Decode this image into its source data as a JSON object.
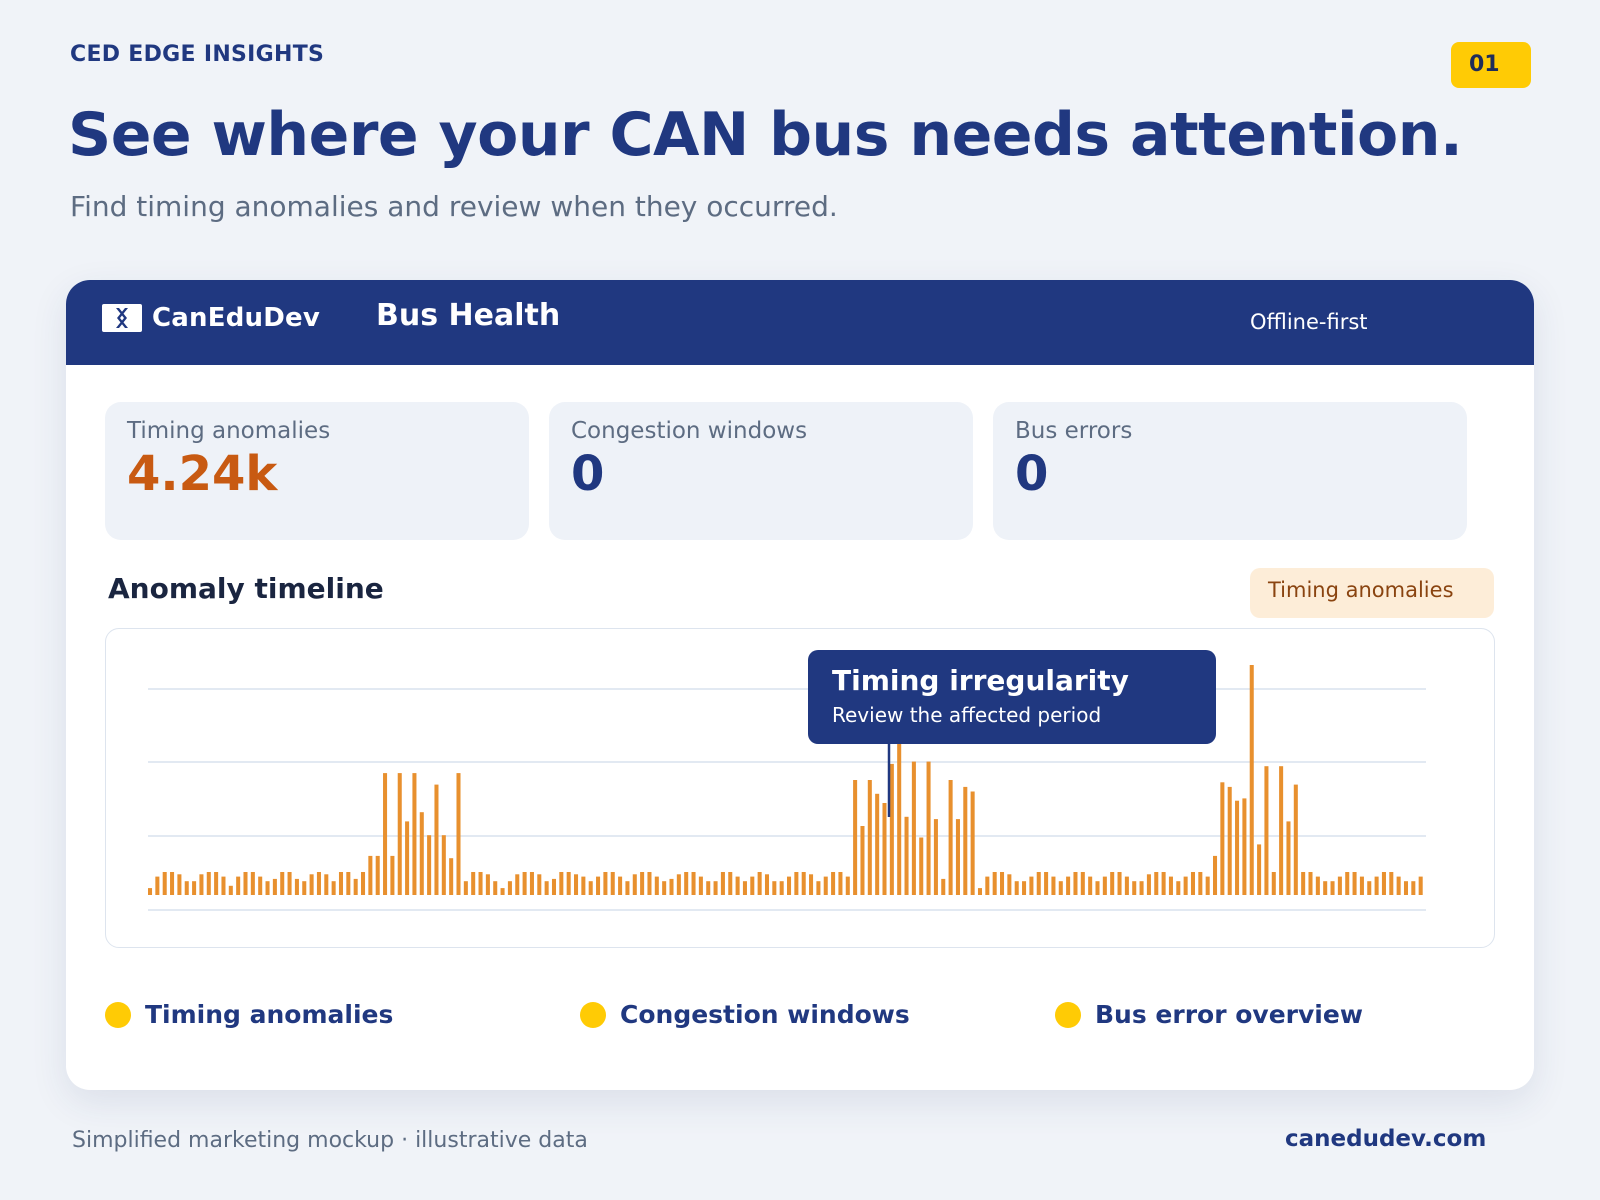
{
  "eyebrow": "CED EDGE INSIGHTS",
  "page_number": "01",
  "headline": "See where your CAN bus needs attention.",
  "subheadline": "Find timing anomalies and review when they occurred.",
  "app": {
    "brand": "CanEduDev",
    "title": "Bus Health",
    "mode": "Offline-first"
  },
  "kpis": [
    {
      "label": "Timing anomalies",
      "value": "4.24k",
      "color": "#c85a12"
    },
    {
      "label": "Congestion windows",
      "value": "0",
      "color": "#203880"
    },
    {
      "label": "Bus errors",
      "value": "0",
      "color": "#203880"
    }
  ],
  "timeline": {
    "title": "Anomaly timeline",
    "chip": "Timing anomalies"
  },
  "tooltip": {
    "title": "Timing irregularity",
    "subtitle": "Review the affected period"
  },
  "legend": [
    {
      "label": "Timing anomalies"
    },
    {
      "label": "Congestion windows"
    },
    {
      "label": "Bus error overview"
    }
  ],
  "footer": {
    "note": "Simplified marketing mockup · illustrative data",
    "site": "canedudev.com"
  },
  "colors": {
    "navy": "#203880",
    "bar": "#e8902e",
    "accent_yellow": "#ffcb05",
    "kpi_orange": "#c85a12"
  },
  "chart_data": {
    "type": "bar",
    "title": "",
    "xlabel": "",
    "ylabel": "",
    "ylim": [
      0,
      100
    ],
    "grid": true,
    "series": [
      {
        "values": [
          3,
          8,
          10,
          10,
          9,
          6,
          6,
          9,
          10,
          10,
          8,
          4,
          8,
          10,
          10,
          8,
          6,
          7,
          10,
          10,
          7,
          6,
          9,
          10,
          9,
          6,
          10,
          10,
          7,
          10,
          17,
          17,
          53,
          17,
          53,
          32,
          53,
          36,
          26,
          48,
          26,
          16,
          53,
          6,
          10,
          10,
          9,
          6,
          3,
          6,
          9,
          10,
          10,
          9,
          6,
          7,
          10,
          10,
          9,
          8,
          6,
          8,
          10,
          10,
          8,
          6,
          9,
          10,
          10,
          8,
          6,
          7,
          9,
          10,
          10,
          8,
          6,
          6,
          10,
          10,
          8,
          6,
          8,
          10,
          9,
          6,
          6,
          8,
          10,
          10,
          9,
          6,
          8,
          10,
          10,
          8,
          50,
          30,
          50,
          44,
          40,
          57,
          72,
          34,
          58,
          25,
          58,
          33,
          7,
          50,
          33,
          47,
          45,
          3,
          8,
          10,
          10,
          9,
          6,
          6,
          8,
          10,
          10,
          8,
          6,
          8,
          10,
          10,
          8,
          6,
          8,
          10,
          10,
          8,
          6,
          6,
          9,
          10,
          10,
          8,
          6,
          8,
          10,
          10,
          8,
          17,
          49,
          47,
          41,
          42,
          100,
          22,
          56,
          10,
          56,
          32,
          48,
          10,
          10,
          8,
          6,
          6,
          8,
          10,
          10,
          8,
          6,
          8,
          10,
          10,
          8,
          6,
          6,
          8
        ]
      }
    ]
  }
}
